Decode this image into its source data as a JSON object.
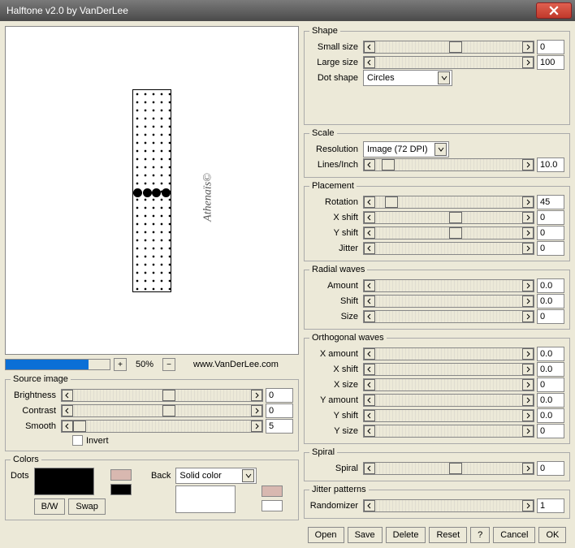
{
  "window": {
    "title": "Halftone v2.0 by VanDerLee"
  },
  "zoom": {
    "percent": "50%",
    "url": "www.VanDerLee.com"
  },
  "sourceImage": {
    "legend": "Source image",
    "brightness_label": "Brightness",
    "brightness_value": "0",
    "contrast_label": "Contrast",
    "contrast_value": "0",
    "smooth_label": "Smooth",
    "smooth_value": "5",
    "invert_label": "Invert"
  },
  "colors": {
    "legend": "Colors",
    "dots_label": "Dots",
    "back_label": "Back",
    "back_mode": "Solid color",
    "bw_button": "B/W",
    "swap_button": "Swap"
  },
  "shape": {
    "legend": "Shape",
    "small_label": "Small size",
    "small_value": "0",
    "large_label": "Large size",
    "large_value": "100",
    "dotshape_label": "Dot shape",
    "dotshape_value": "Circles"
  },
  "scale": {
    "legend": "Scale",
    "resolution_label": "Resolution",
    "resolution_value": "Image (72 DPI)",
    "lines_label": "Lines/Inch",
    "lines_value": "10.0"
  },
  "placement": {
    "legend": "Placement",
    "rotation_label": "Rotation",
    "rotation_value": "45",
    "xshift_label": "X shift",
    "xshift_value": "0",
    "yshift_label": "Y shift",
    "yshift_value": "0",
    "jitter_label": "Jitter",
    "jitter_value": "0"
  },
  "radial": {
    "legend": "Radial waves",
    "amount_label": "Amount",
    "amount_value": "0.0",
    "shift_label": "Shift",
    "shift_value": "0.0",
    "size_label": "Size",
    "size_value": "0"
  },
  "ortho": {
    "legend": "Orthogonal waves",
    "xamount_label": "X amount",
    "xamount_value": "0.0",
    "xshift_label": "X shift",
    "xshift_value": "0.0",
    "xsize_label": "X size",
    "xsize_value": "0",
    "yamount_label": "Y amount",
    "yamount_value": "0.0",
    "yshift_label": "Y shift",
    "yshift_value": "0.0",
    "ysize_label": "Y size",
    "ysize_value": "0"
  },
  "spiral": {
    "legend": "Spiral",
    "spiral_label": "Spiral",
    "spiral_value": "0"
  },
  "jitter": {
    "legend": "Jitter patterns",
    "randomizer_label": "Randomizer",
    "randomizer_value": "1"
  },
  "buttons": {
    "open": "Open",
    "save": "Save",
    "delete": "Delete",
    "reset": "Reset",
    "help": "?",
    "cancel": "Cancel",
    "ok": "OK"
  },
  "watermark": "Athenaïs©"
}
